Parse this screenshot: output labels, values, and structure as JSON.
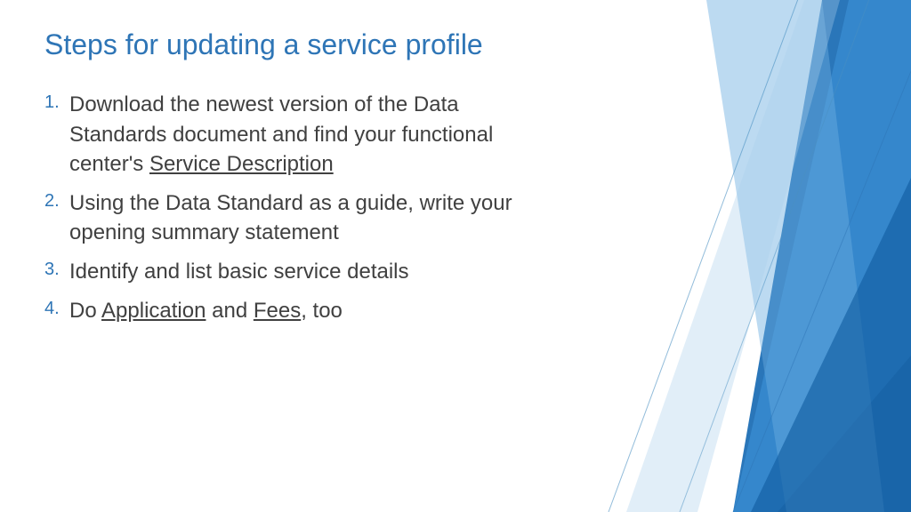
{
  "title": "Steps for updating a service profile",
  "steps": {
    "item1_a": "Download the newest version of the Data Standards document and find your functional center's ",
    "item1_u": "Service Description",
    "item2": "Using the Data Standard as a guide, write your opening summary statement",
    "item3": "Identify and list basic service details",
    "item4_a": "Do ",
    "item4_u1": "Application",
    "item4_b": " and ",
    "item4_u2": "Fees",
    "item4_c": ", too"
  }
}
